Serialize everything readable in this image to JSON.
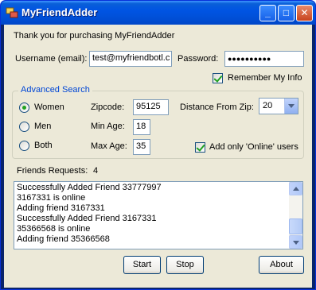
{
  "window": {
    "title": "MyFriendAdder",
    "controls": {
      "minimize": "_",
      "maximize": "□",
      "close": "✕"
    }
  },
  "header": {
    "thanks": "Thank you for purchasing MyFriendAdder"
  },
  "login": {
    "username_label": "Username (email):",
    "username_value": "test@myfriendbotl.c",
    "password_label": "Password:",
    "password_value": "●●●●●●●●●●",
    "remember_label": "Remember My Info",
    "remember_checked": true
  },
  "search": {
    "group_title": "Advanced Search",
    "gender_options": [
      "Women",
      "Men",
      "Both"
    ],
    "gender_selected": "Women",
    "zipcode_label": "Zipcode:",
    "zipcode_value": "95125",
    "min_age_label": "Min Age:",
    "min_age_value": "18",
    "max_age_label": "Max Age:",
    "max_age_value": "35",
    "distance_label": "Distance From Zip:",
    "distance_value": "20",
    "online_only_label": "Add only 'Online' users",
    "online_only_checked": true
  },
  "requests": {
    "label": "Friends Requests:",
    "count": "4"
  },
  "log": {
    "lines": [
      "Successfully Added Friend 33777997",
      "3167331 is online",
      "Adding friend 3167331",
      "Successfully Added Friend 3167331",
      "35366568 is online",
      "Adding friend 35366568"
    ]
  },
  "buttons": {
    "start": "Start",
    "stop": "Stop",
    "about": "About"
  },
  "colors": {
    "title_bar": "#0054e3",
    "group_title": "#0046d5",
    "face": "#ece9d8",
    "check": "#21a121"
  },
  "icons": {
    "app": "app-window-icon"
  }
}
